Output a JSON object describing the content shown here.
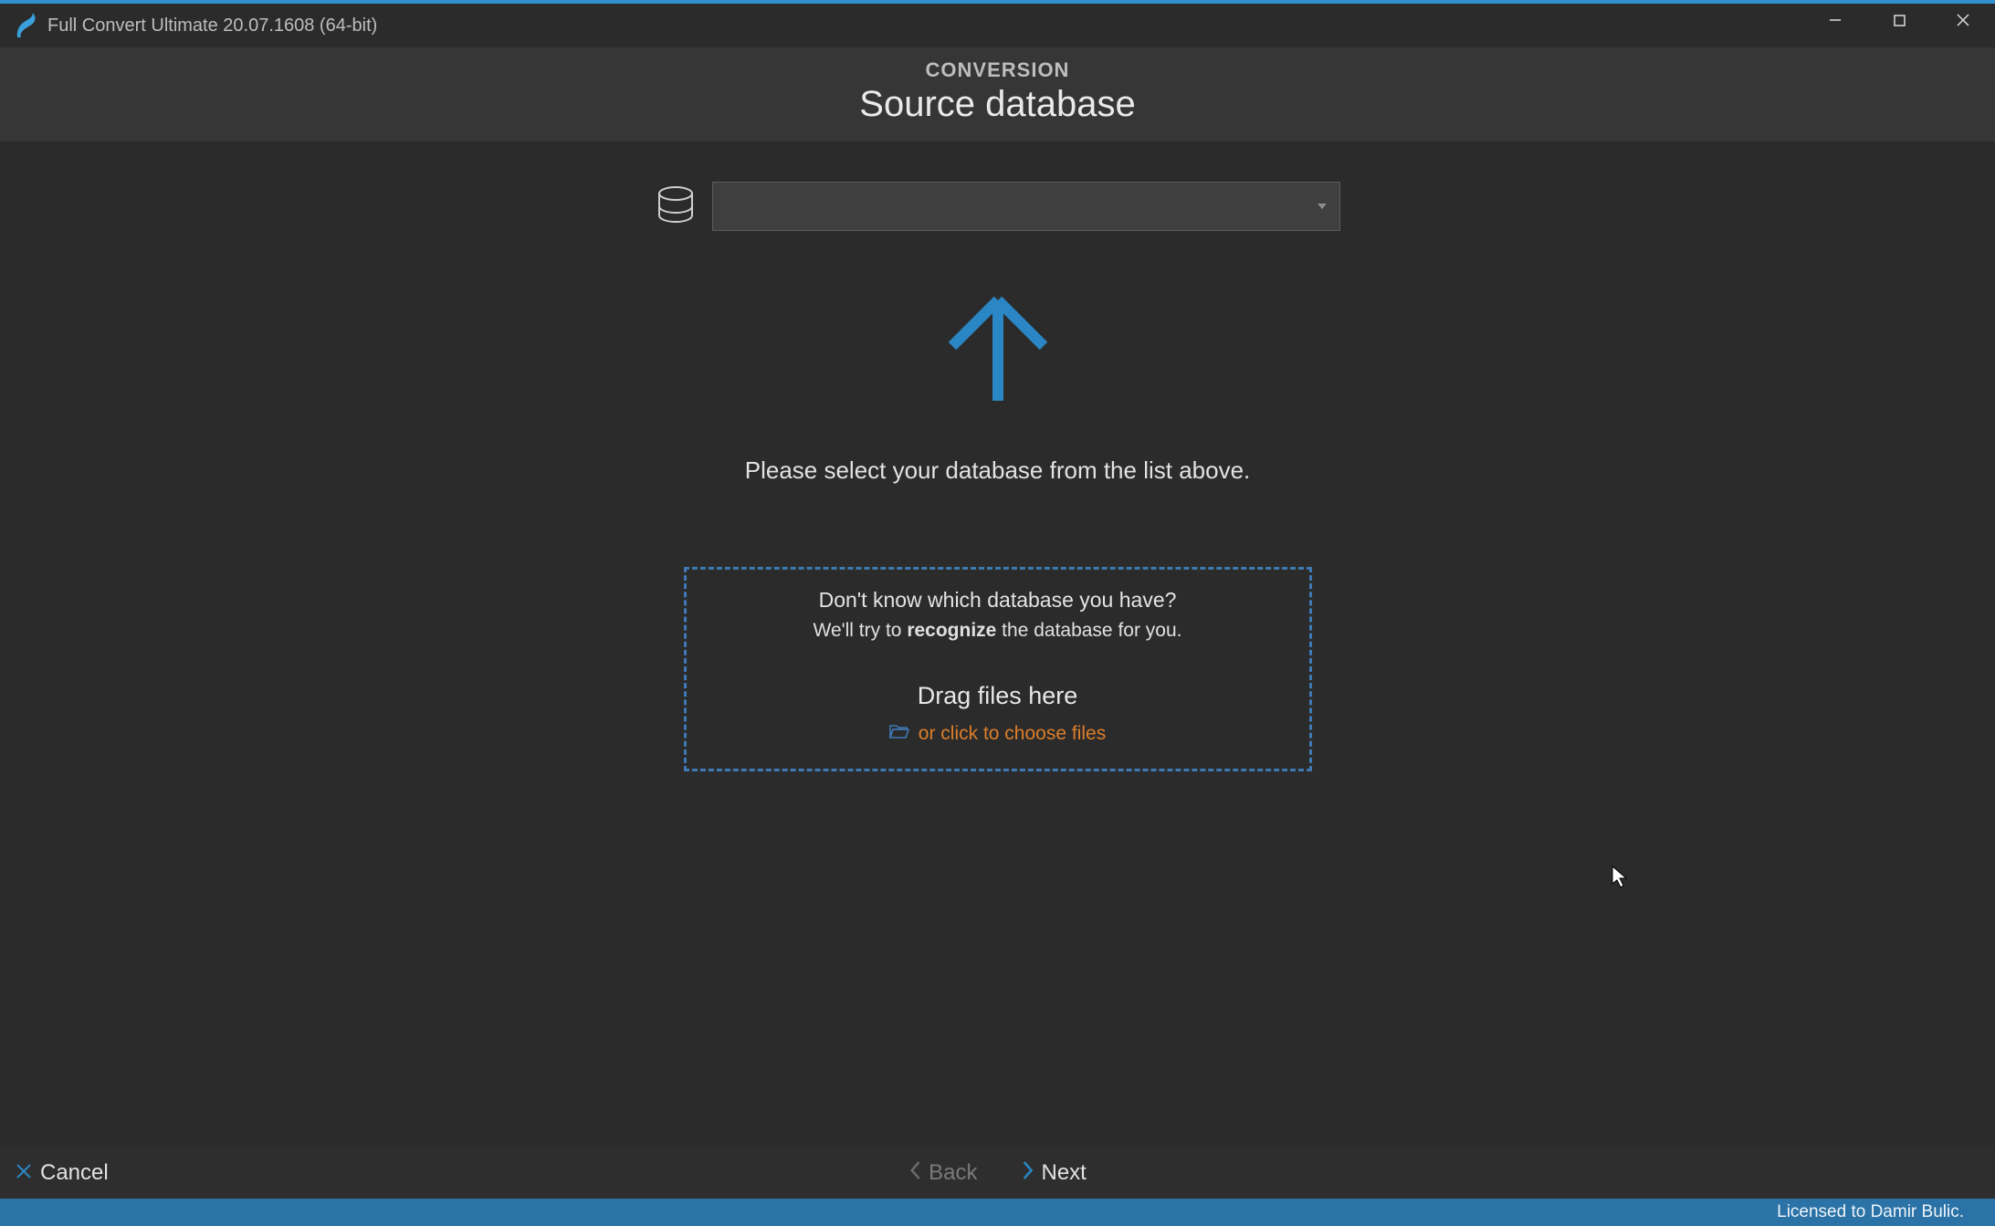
{
  "window": {
    "title": "Full Convert Ultimate 20.07.1608 (64-bit)"
  },
  "header": {
    "eyebrow": "CONVERSION",
    "title": "Source database"
  },
  "select": {
    "value": ""
  },
  "helper": "Please select your database from the list above.",
  "dropzone": {
    "question": "Don't know which database you have?",
    "sub_pre": "We'll try to ",
    "sub_strong": "recognize",
    "sub_post": " the database for you.",
    "drag": "Drag files here",
    "choose": "or click to choose files"
  },
  "footer": {
    "cancel": "Cancel",
    "back": "Back",
    "next": "Next"
  },
  "status": {
    "license": "Licensed to Damir Bulic."
  }
}
